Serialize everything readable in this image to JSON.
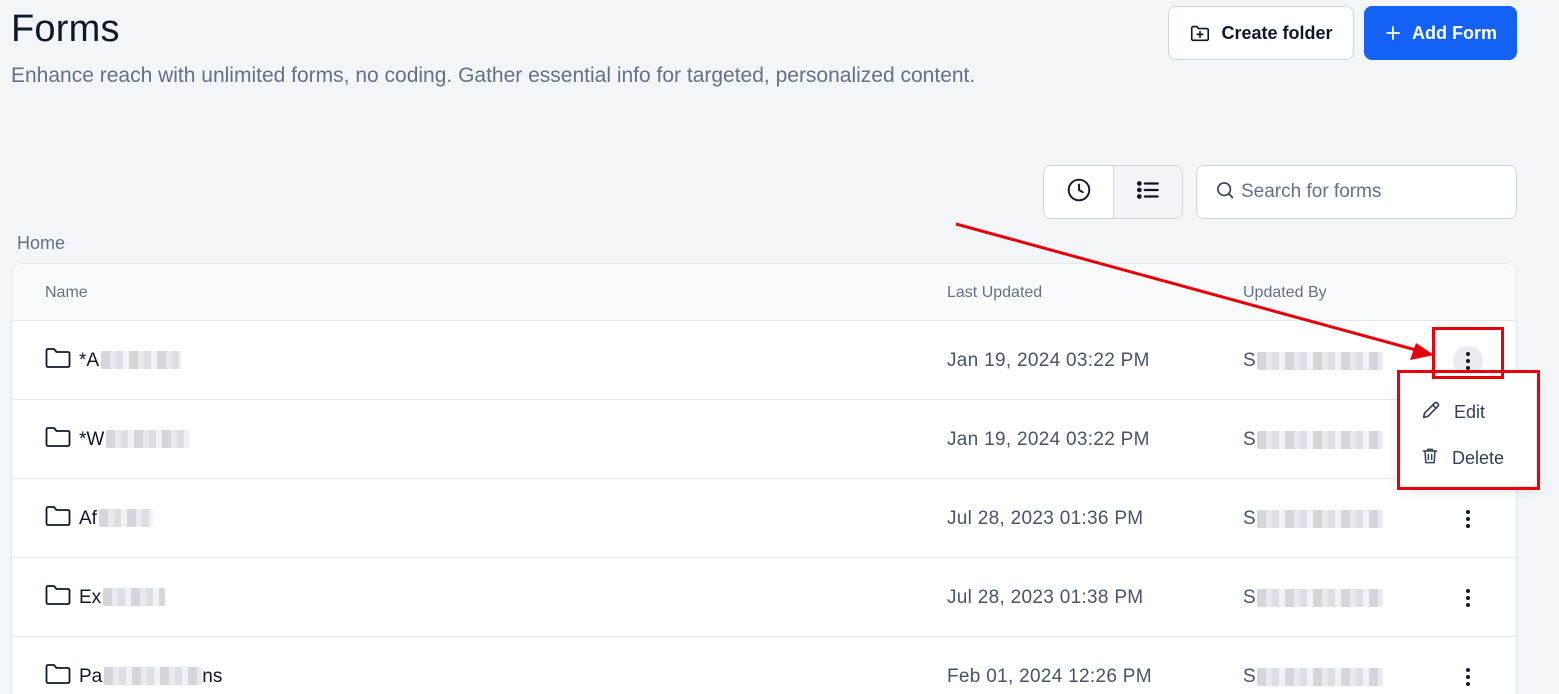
{
  "header": {
    "title": "Forms",
    "subtitle": "Enhance reach with unlimited forms, no coding. Gather essential info for targeted, personalized content.",
    "create_folder_label": "Create folder",
    "add_form_label": "Add Form"
  },
  "toolbar": {
    "views": [
      {
        "icon": "clock-icon",
        "active": false
      },
      {
        "icon": "list-icon",
        "active": true
      }
    ],
    "search_placeholder": "Search for forms"
  },
  "breadcrumb": "Home",
  "table": {
    "columns": [
      "Name",
      "Last Updated",
      "Updated By"
    ],
    "rows": [
      {
        "name_prefix": "*A",
        "last_updated": "Jan 19, 2024 03:22 PM",
        "updated_by_prefix": "S"
      },
      {
        "name_prefix": "*W",
        "last_updated": "Jan 19, 2024 03:22 PM",
        "updated_by_prefix": "S"
      },
      {
        "name_prefix": "Af",
        "last_updated": "Jul 28, 2023 01:36 PM",
        "updated_by_prefix": "S"
      },
      {
        "name_prefix": "Ex",
        "last_updated": "Jul 28, 2023 01:38 PM",
        "updated_by_prefix": "S"
      },
      {
        "name_prefix": "Pa",
        "name_suffix": "ns",
        "last_updated": "Feb 01, 2024 12:26 PM",
        "updated_by_prefix": "S"
      }
    ]
  },
  "row_menu": {
    "edit_label": "Edit",
    "delete_label": "Delete"
  },
  "colors": {
    "primary": "#1361f5",
    "annotation": "#e8000b",
    "background": "#f2f6f9"
  }
}
